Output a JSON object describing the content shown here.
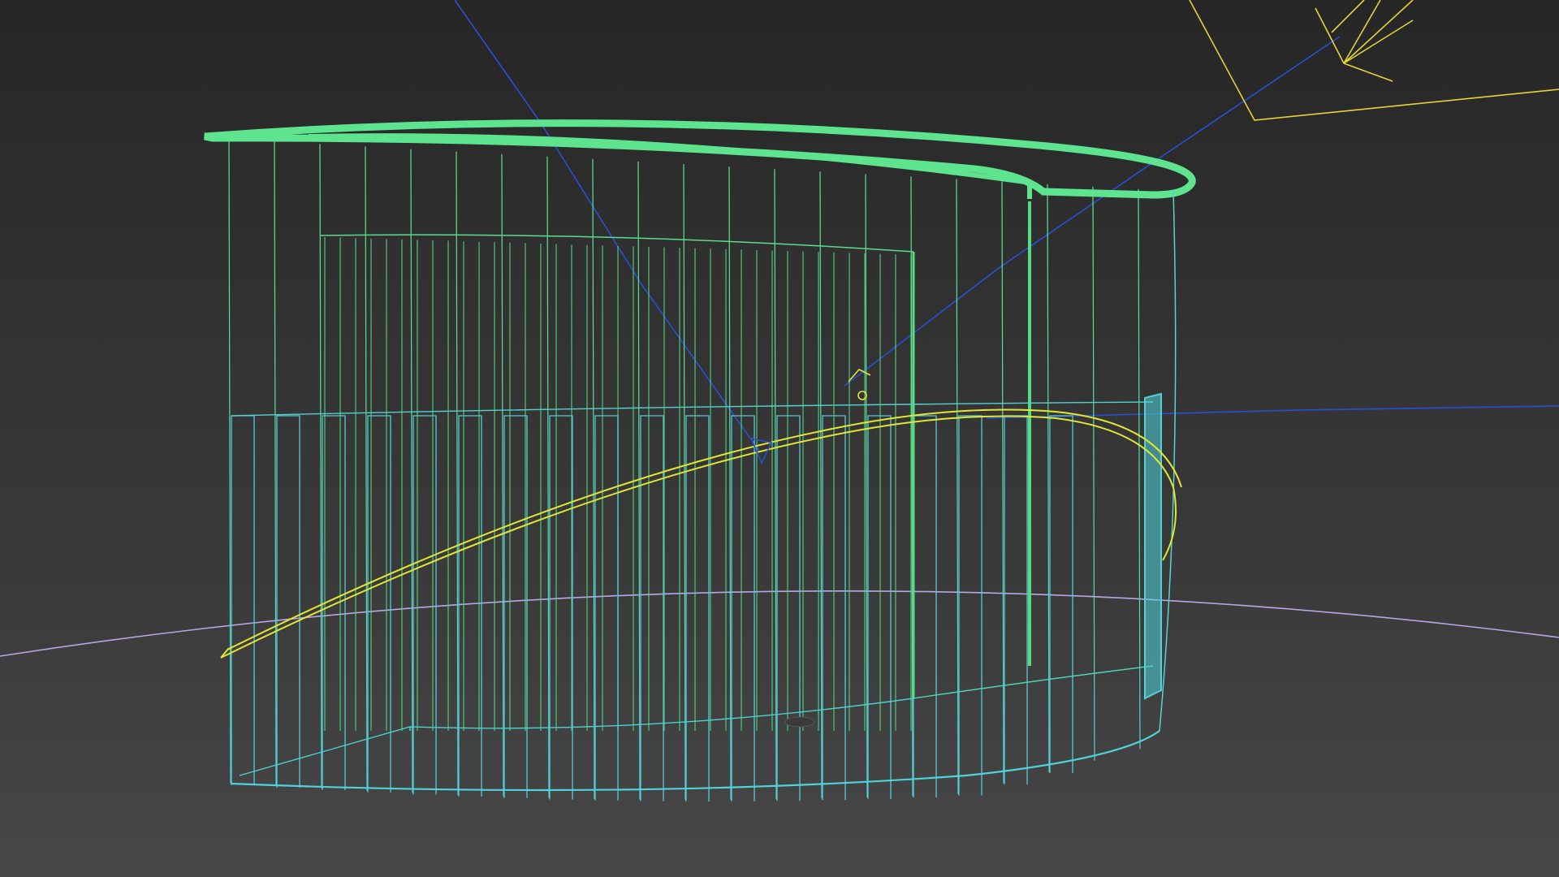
{
  "viewport": {
    "display_mode": "wireframe",
    "background_top": "#262626",
    "background_bottom": "#474747"
  },
  "colors": {
    "ground_circle": "#b9a6e6",
    "wire_top": "#5ee38e",
    "wire_bottom": "#4fd3d8",
    "inner_wire": "#54dc7e",
    "spline": "#e1e636",
    "light_and_camera": "#e6d23a",
    "target_lines": "#2a4fd0"
  },
  "objects": [
    {
      "name": "curved-wall",
      "kind": "geometry",
      "render": "wireframe"
    },
    {
      "name": "inner-arc-wall",
      "kind": "geometry",
      "render": "wireframe"
    },
    {
      "name": "comb-teeth-band",
      "kind": "geometry",
      "render": "wireframe"
    },
    {
      "name": "helix-spline",
      "kind": "shape",
      "render": "spline"
    },
    {
      "name": "ground-circle",
      "kind": "shape",
      "render": "spline"
    },
    {
      "name": "spot-light",
      "kind": "light",
      "render": "gizmo"
    },
    {
      "name": "camera-target",
      "kind": "helper",
      "render": "gizmo"
    }
  ]
}
